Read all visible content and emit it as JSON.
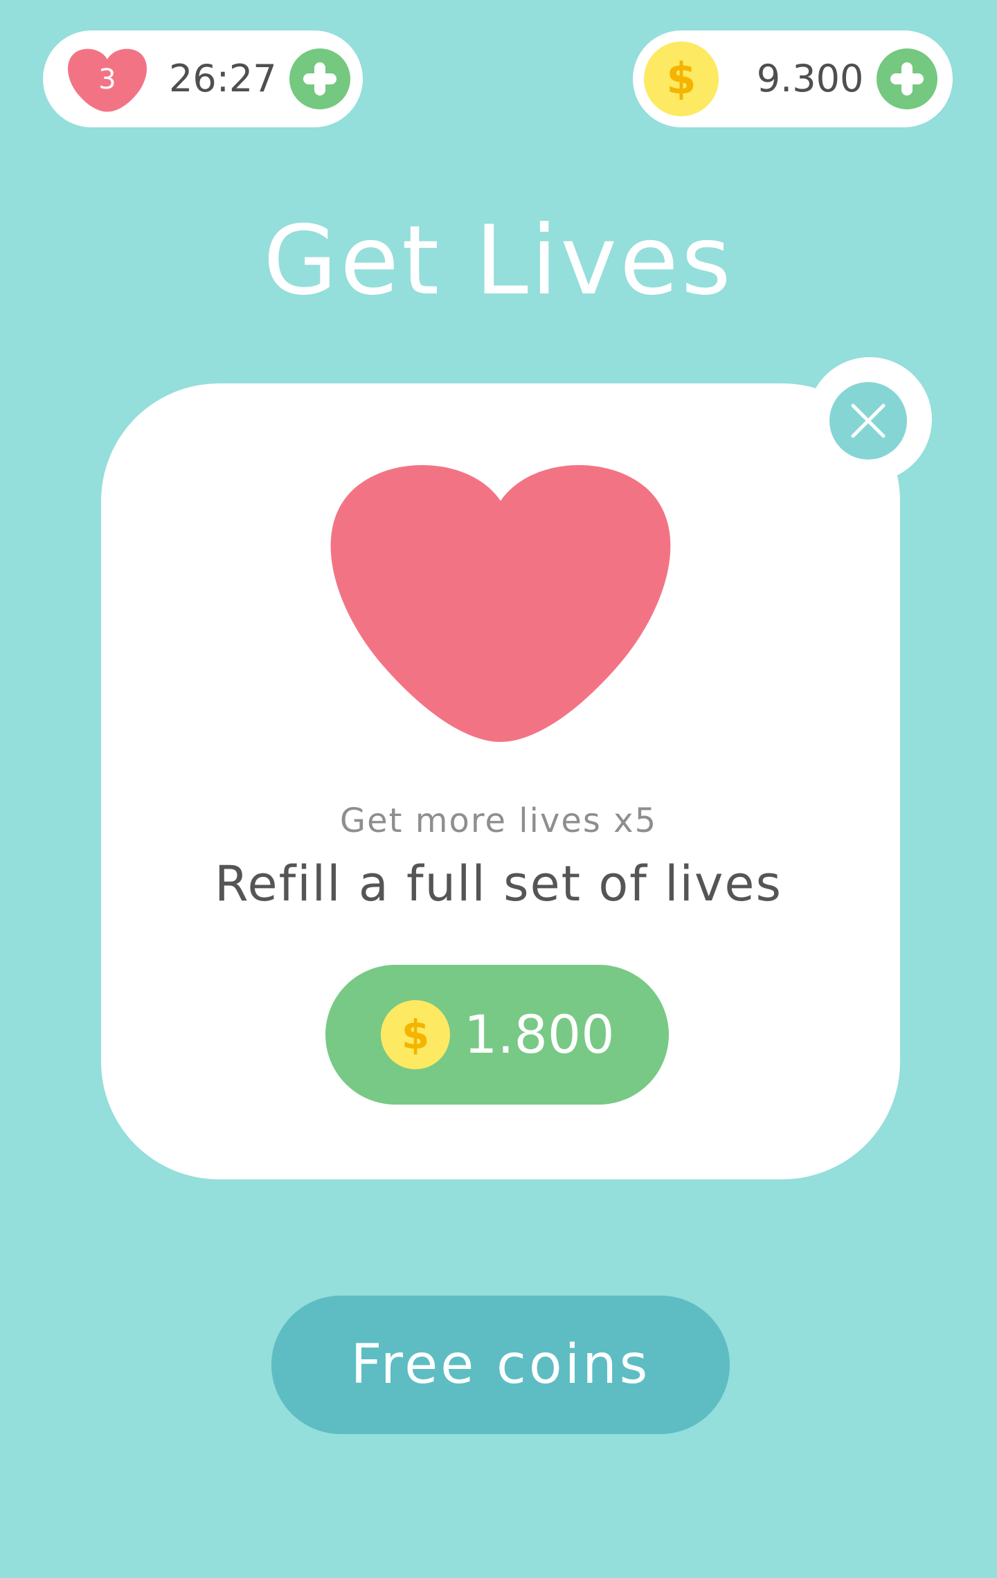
{
  "header": {
    "lives": {
      "count": "3",
      "timer": "26:27",
      "heart_icon": "heart-icon",
      "plus_icon": "plus-icon"
    },
    "coins": {
      "symbol": "$",
      "amount": "9.300",
      "coin_icon": "coin-icon",
      "plus_icon": "plus-icon"
    }
  },
  "title": "Get Lives",
  "offer": {
    "icon": "heart-icon",
    "subtitle": "Get more lives x5",
    "description": "Refill a full set of lives",
    "price_symbol": "$",
    "price": "1.800"
  },
  "close_icon": "close-icon",
  "free_coins_label": "Free coins",
  "colors": {
    "background": "#94dedb",
    "heart": "#f27484",
    "green": "#75c87f",
    "coin": "#fde962",
    "coin_symbol": "#f4b400",
    "teal_button": "#5dbdc3",
    "close": "#86d5d5"
  }
}
